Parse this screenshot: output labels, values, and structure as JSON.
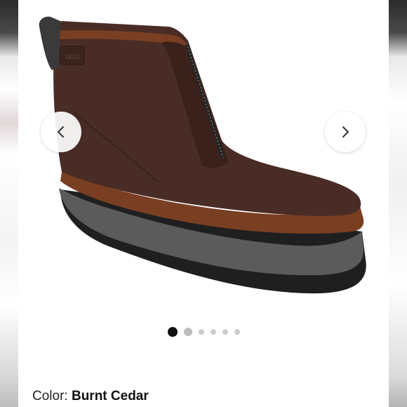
{
  "gallery": {
    "prev_icon": "chevron-left-icon",
    "next_icon": "chevron-right-icon",
    "dots": [
      true,
      false,
      false,
      false,
      false,
      false
    ],
    "brand_tag": "UGG"
  },
  "product": {
    "color_label": "Color:",
    "color_value": "Burnt Cedar"
  }
}
